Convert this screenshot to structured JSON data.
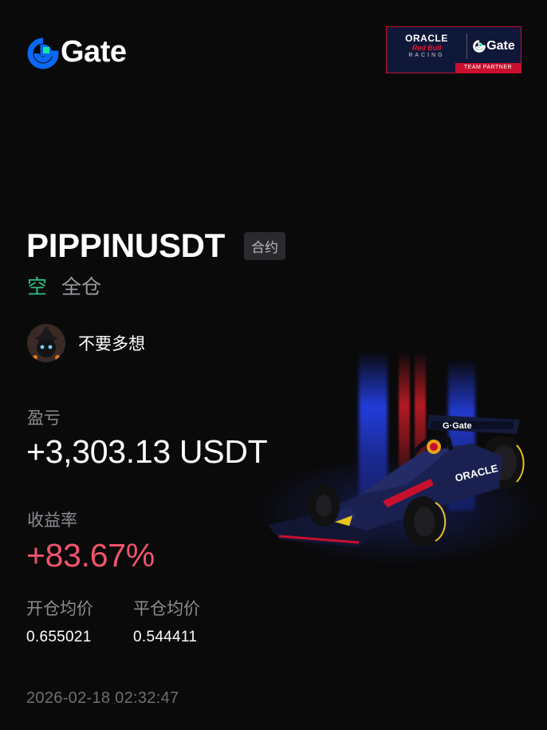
{
  "brand": {
    "logo_text": "Gate",
    "accent": "#0a68f4",
    "accent_secondary": "#17e6a1"
  },
  "partner": {
    "oracle_text": "ORACLE",
    "red_bull_text": "Red Bull",
    "racing_text": "RACING",
    "gate_text": "Gate",
    "strip_text": "TEAM PARTNER"
  },
  "position": {
    "pair": "PIPPINUSDT",
    "contract_tag": "合约",
    "direction": "空",
    "margin_mode": "全仓",
    "direction_color": "#2fbd85"
  },
  "user": {
    "name": "不要多想",
    "avatar_icon": "black-cat-witch-hat-avatar"
  },
  "pnl": {
    "label": "盈亏",
    "value": "+3,303.13 USDT"
  },
  "roi": {
    "label": "收益率",
    "value": "+83.67%",
    "color": "#f0556b"
  },
  "prices": {
    "entry_label": "开仓均价",
    "entry_value": "0.655021",
    "close_label": "平仓均价",
    "close_value": "0.544411"
  },
  "timestamp": "2026-02-18 02:32:47"
}
